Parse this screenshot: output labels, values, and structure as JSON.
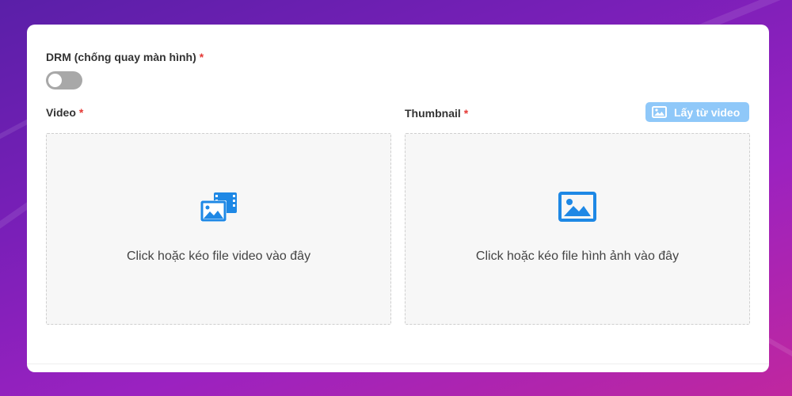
{
  "drm": {
    "label": "DRM (chống quay màn hình)",
    "required": "*",
    "enabled": false
  },
  "video": {
    "label": "Video",
    "required": "*",
    "dropzone_text": "Click hoặc kéo file video vào đây",
    "icon": "video-gallery-icon"
  },
  "thumbnail": {
    "label": "Thumbnail",
    "required": "*",
    "extract_button_label": "Lấy từ video",
    "extract_button_icon": "image-icon",
    "dropzone_text": "Click hoặc kéo file hình ảnh vào đây",
    "icon": "image-icon"
  },
  "colors": {
    "accent": "#1e88e5",
    "button_light_blue": "#8fc8f9",
    "required_star": "#e53935",
    "toggle_off": "#a8a8a8"
  }
}
